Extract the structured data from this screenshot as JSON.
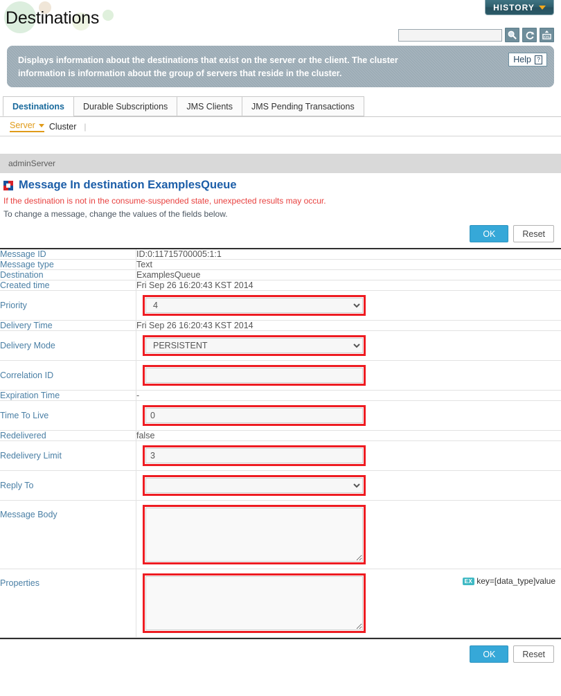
{
  "header": {
    "title": "Destinations",
    "history_button": "HISTORY",
    "search_placeholder": "",
    "search_value": "",
    "icons": [
      "search-icon",
      "refresh-icon",
      "xml-export-icon"
    ]
  },
  "info_banner": {
    "text": "Displays information about the destinations that exist on the server or the client. The cluster information is information about the group of servers that reside in the cluster.",
    "help_label": "Help"
  },
  "tabs": [
    {
      "label": "Destinations",
      "active": true
    },
    {
      "label": "Durable Subscriptions",
      "active": false
    },
    {
      "label": "JMS Clients",
      "active": false
    },
    {
      "label": "JMS Pending Transactions",
      "active": false
    }
  ],
  "subnav": [
    {
      "label": "Server",
      "active": true
    },
    {
      "label": "Cluster",
      "active": false
    }
  ],
  "server_bar": {
    "name": "adminServer"
  },
  "message_section": {
    "title": "Message In destination ExamplesQueue",
    "warning": "If the destination is not in the consume-suspended state, unexpected results may occur.",
    "subtitle": "To change a message, change the values of the fields below."
  },
  "buttons": {
    "ok": "OK",
    "reset": "Reset"
  },
  "form_rows": [
    {
      "label": "Message ID",
      "type": "text",
      "value": "ID:0:11715700005:1:1",
      "highlighted": false
    },
    {
      "label": "Message type",
      "type": "text",
      "value": "Text",
      "highlighted": false
    },
    {
      "label": "Destination",
      "type": "text",
      "value": "ExamplesQueue",
      "highlighted": false
    },
    {
      "label": "Created time",
      "type": "text",
      "value": "Fri Sep 26 16:20:43 KST 2014",
      "highlighted": false
    },
    {
      "label": "Priority",
      "type": "select",
      "value": "4",
      "highlighted": true
    },
    {
      "label": "Delivery Time",
      "type": "text",
      "value": "Fri Sep 26 16:20:43 KST 2014",
      "highlighted": false
    },
    {
      "label": "Delivery Mode",
      "type": "select",
      "value": "PERSISTENT",
      "highlighted": true
    },
    {
      "label": "Correlation ID",
      "type": "input",
      "value": "",
      "highlighted": true
    },
    {
      "label": "Expiration Time",
      "type": "text",
      "value": "-",
      "highlighted": false
    },
    {
      "label": "Time To Live",
      "type": "input",
      "value": "0",
      "highlighted": true
    },
    {
      "label": "Redelivered",
      "type": "text",
      "value": "false",
      "highlighted": false
    },
    {
      "label": "Redelivery Limit",
      "type": "input",
      "value": "3",
      "highlighted": true
    },
    {
      "label": "Reply To",
      "type": "select",
      "value": "",
      "highlighted": true
    },
    {
      "label": "Message Body",
      "type": "textarea",
      "value": "",
      "highlighted": true
    },
    {
      "label": "Properties",
      "type": "textarea",
      "value": "",
      "highlighted": true,
      "hint": "key=[data_type]value",
      "hint_badge": "EX"
    }
  ],
  "colors": {
    "accent_blue": "#1c5ea8",
    "label_blue": "#4a7fa5",
    "warning_red": "#e8413f",
    "highlight_red": "#ee1c22",
    "ok_button": "#36a8d8",
    "orange": "#e09b1a",
    "banner_gray": "#9aaab4"
  }
}
